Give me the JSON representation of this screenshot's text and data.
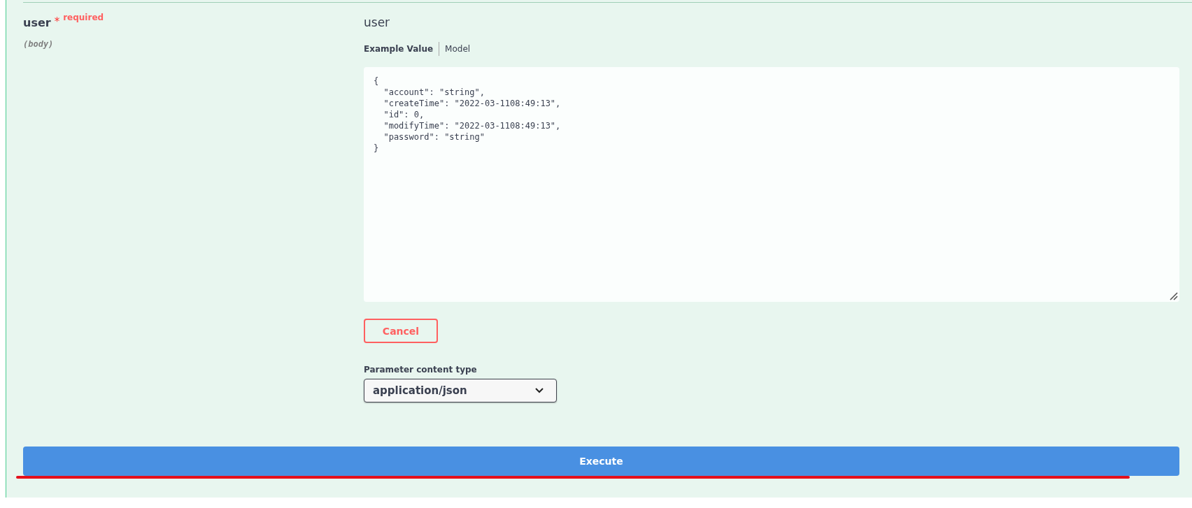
{
  "parameter": {
    "name": "user",
    "required_mark": "*",
    "required_label": "required",
    "location": "(body)",
    "title": "user"
  },
  "tabs": [
    {
      "label": "Example Value",
      "selected": true
    },
    {
      "label": "Model",
      "selected": false
    }
  ],
  "example_lines": [
    "{",
    "  \"account\": \"string\",",
    "  \"createTime\": \"2022-03-1108:49:13\",",
    "  \"id\": 0,",
    "  \"modifyTime\": \"2022-03-1108:49:13\",",
    "  \"password\": \"string\"",
    "}"
  ],
  "cancel_button": "Cancel",
  "content_type": {
    "label": "Parameter content type",
    "value": "application/json"
  },
  "execute_button": "Execute"
}
